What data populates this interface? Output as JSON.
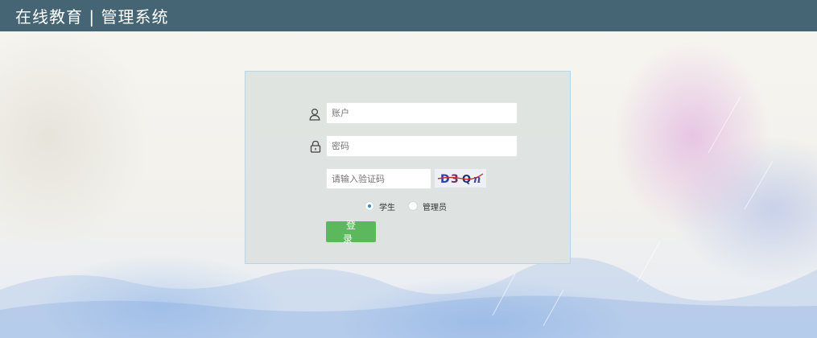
{
  "header": {
    "title": "在线教育 | 管理系统"
  },
  "login": {
    "account_placeholder": "账户",
    "password_placeholder": "密码",
    "captcha_placeholder": "请输入验证码",
    "captcha_text": "D3Qn",
    "roles": [
      {
        "label": "学生",
        "checked": true
      },
      {
        "label": "管理员",
        "checked": false
      }
    ],
    "submit_label": "登 录"
  },
  "colors": {
    "header_bg": "#466574",
    "button_bg": "#5cb85c",
    "radio_accent": "#2f88c9"
  }
}
